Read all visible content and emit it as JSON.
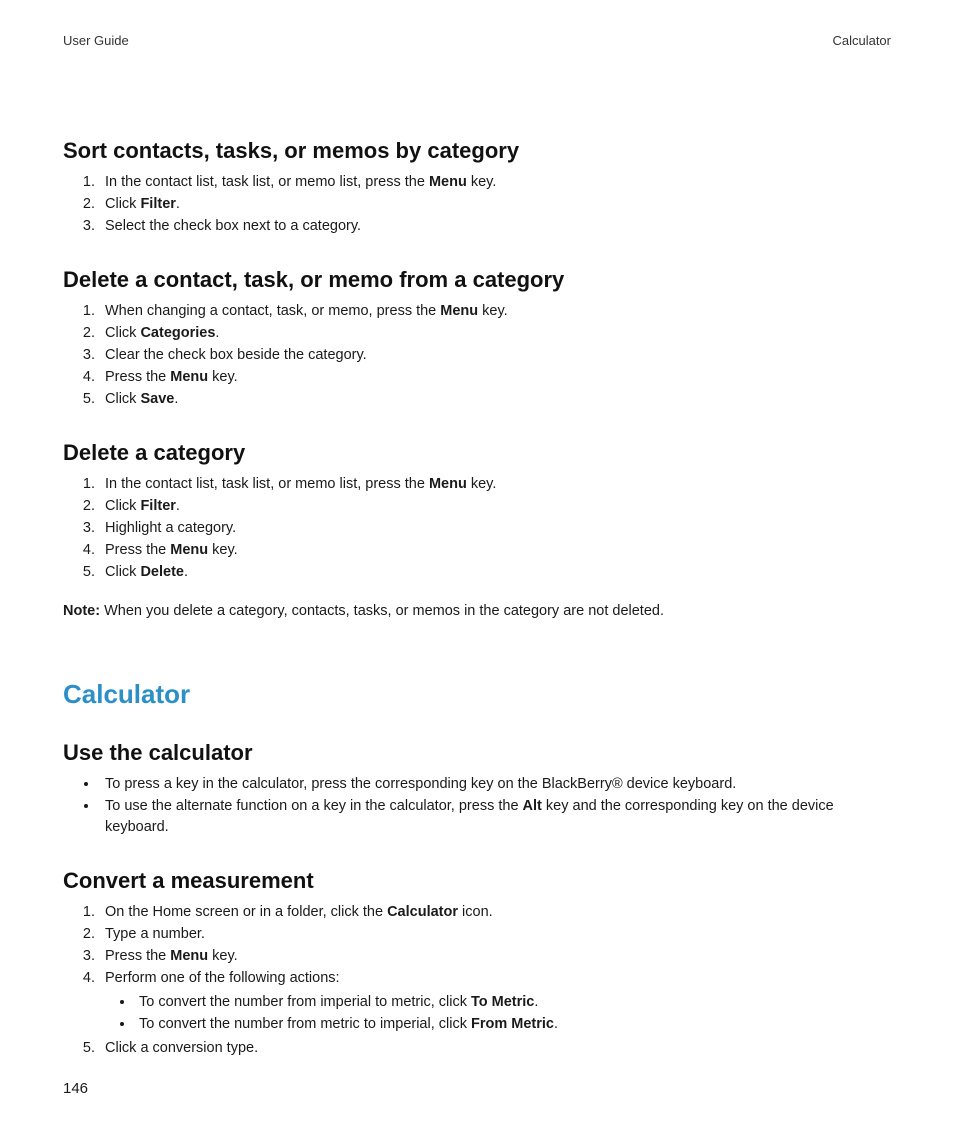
{
  "header": {
    "left": "User Guide",
    "right": "Calculator"
  },
  "page_number": "146",
  "sections": {
    "sort": {
      "title": "Sort contacts, tasks, or memos by category",
      "steps": [
        {
          "pre": "In the contact list, task list, or memo list, press the ",
          "bold": "Menu",
          "post": " key."
        },
        {
          "pre": "Click ",
          "bold": "Filter",
          "post": "."
        },
        {
          "pre": "Select the check box next to a category.",
          "bold": "",
          "post": ""
        }
      ]
    },
    "delete_item": {
      "title": "Delete a contact, task, or memo from a category",
      "steps": [
        {
          "pre": "When changing a contact, task, or memo, press the ",
          "bold": "Menu",
          "post": " key."
        },
        {
          "pre": "Click ",
          "bold": "Categories",
          "post": "."
        },
        {
          "pre": "Clear the check box beside the category.",
          "bold": "",
          "post": ""
        },
        {
          "pre": "Press the ",
          "bold": "Menu",
          "post": " key."
        },
        {
          "pre": "Click ",
          "bold": "Save",
          "post": "."
        }
      ]
    },
    "delete_category": {
      "title": "Delete a category",
      "steps": [
        {
          "pre": "In the contact list, task list, or memo list, press the ",
          "bold": "Menu",
          "post": " key."
        },
        {
          "pre": "Click ",
          "bold": "Filter",
          "post": "."
        },
        {
          "pre": "Highlight a category.",
          "bold": "",
          "post": ""
        },
        {
          "pre": "Press the ",
          "bold": "Menu",
          "post": " key."
        },
        {
          "pre": "Click ",
          "bold": "Delete",
          "post": "."
        }
      ],
      "note_label": "Note:",
      "note_text": "  When you delete a category, contacts, tasks, or memos in the category are not deleted."
    },
    "calculator": {
      "title": "Calculator",
      "use": {
        "title": "Use the calculator",
        "bullets": [
          {
            "pre": "To press a key in the calculator, press the corresponding key on the BlackBerry® device keyboard.",
            "bold": "",
            "post": ""
          },
          {
            "pre": "To use the alternate function on a key in the calculator, press the ",
            "bold": "Alt",
            "post": " key and the corresponding key on the device keyboard."
          }
        ]
      },
      "convert": {
        "title": "Convert a measurement",
        "steps": [
          {
            "pre": "On the Home screen or in a folder, click the ",
            "bold": "Calculator",
            "post": " icon."
          },
          {
            "pre": "Type a number.",
            "bold": "",
            "post": ""
          },
          {
            "pre": "Press the ",
            "bold": "Menu",
            "post": " key."
          },
          {
            "pre": "Perform one of the following actions:",
            "bold": "",
            "post": "",
            "sub": [
              {
                "pre": "To convert the number from imperial to metric, click ",
                "bold": "To Metric",
                "post": "."
              },
              {
                "pre": "To convert the number from metric to imperial, click ",
                "bold": "From Metric",
                "post": "."
              }
            ]
          },
          {
            "pre": "Click a conversion type.",
            "bold": "",
            "post": ""
          }
        ]
      }
    }
  }
}
